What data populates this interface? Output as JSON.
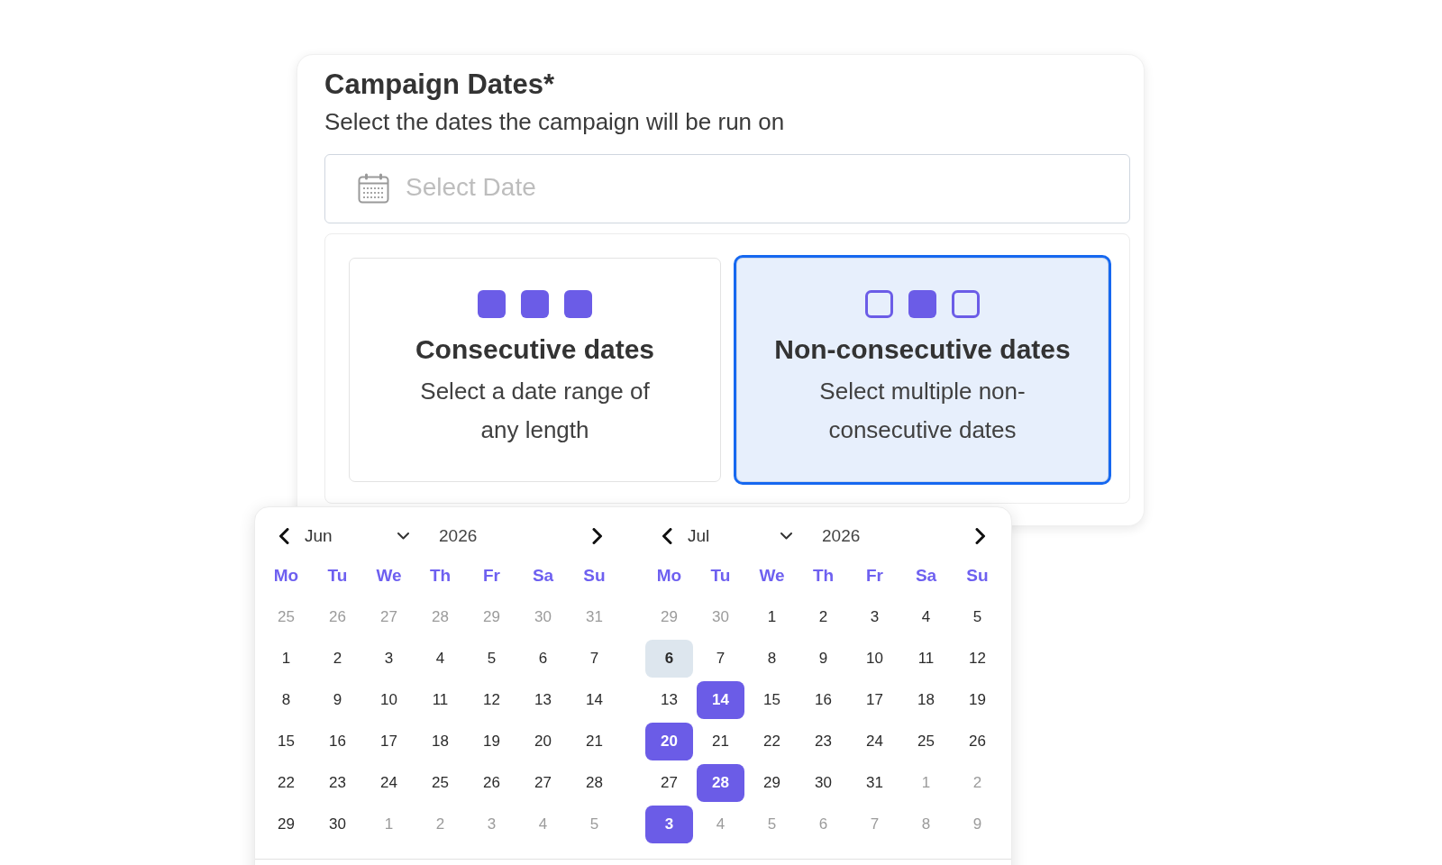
{
  "section": {
    "title": "Campaign Dates*",
    "subtitle": "Select the dates the campaign will be run on"
  },
  "date_field": {
    "placeholder": "Select Date"
  },
  "date_modes": [
    {
      "kind": "consecutive",
      "title": "Consecutive dates",
      "description": "Select a date range of any length",
      "selected": false
    },
    {
      "kind": "non_consecutive",
      "title": "Non-consecutive dates",
      "description": "Select multiple non-consecutive dates",
      "selected": true
    }
  ],
  "date_picker": {
    "months": [
      {
        "month": "Jun",
        "year": "2026",
        "weekdays": [
          "Mo",
          "Tu",
          "We",
          "Th",
          "Fr",
          "Sa",
          "Su"
        ],
        "weeks": [
          [
            {
              "day": "25",
              "outside": true,
              "today": false,
              "selected": false
            },
            {
              "day": "26",
              "outside": true,
              "today": false,
              "selected": false
            },
            {
              "day": "27",
              "outside": true,
              "today": false,
              "selected": false
            },
            {
              "day": "28",
              "outside": true,
              "today": false,
              "selected": false
            },
            {
              "day": "29",
              "outside": true,
              "today": false,
              "selected": false
            },
            {
              "day": "30",
              "outside": true,
              "today": false,
              "selected": false
            },
            {
              "day": "31",
              "outside": true,
              "today": false,
              "selected": false
            }
          ],
          [
            {
              "day": "1",
              "outside": false,
              "today": false,
              "selected": false
            },
            {
              "day": "2",
              "outside": false,
              "today": false,
              "selected": false
            },
            {
              "day": "3",
              "outside": false,
              "today": false,
              "selected": false
            },
            {
              "day": "4",
              "outside": false,
              "today": false,
              "selected": false
            },
            {
              "day": "5",
              "outside": false,
              "today": false,
              "selected": false
            },
            {
              "day": "6",
              "outside": false,
              "today": false,
              "selected": false
            },
            {
              "day": "7",
              "outside": false,
              "today": false,
              "selected": false
            }
          ],
          [
            {
              "day": "8",
              "outside": false,
              "today": false,
              "selected": false
            },
            {
              "day": "9",
              "outside": false,
              "today": false,
              "selected": false
            },
            {
              "day": "10",
              "outside": false,
              "today": false,
              "selected": false
            },
            {
              "day": "11",
              "outside": false,
              "today": false,
              "selected": false
            },
            {
              "day": "12",
              "outside": false,
              "today": false,
              "selected": false
            },
            {
              "day": "13",
              "outside": false,
              "today": false,
              "selected": false
            },
            {
              "day": "14",
              "outside": false,
              "today": false,
              "selected": false
            }
          ],
          [
            {
              "day": "15",
              "outside": false,
              "today": false,
              "selected": false
            },
            {
              "day": "16",
              "outside": false,
              "today": false,
              "selected": false
            },
            {
              "day": "17",
              "outside": false,
              "today": false,
              "selected": false
            },
            {
              "day": "18",
              "outside": false,
              "today": false,
              "selected": false
            },
            {
              "day": "19",
              "outside": false,
              "today": false,
              "selected": false
            },
            {
              "day": "20",
              "outside": false,
              "today": false,
              "selected": false
            },
            {
              "day": "21",
              "outside": false,
              "today": false,
              "selected": false
            }
          ],
          [
            {
              "day": "22",
              "outside": false,
              "today": false,
              "selected": false
            },
            {
              "day": "23",
              "outside": false,
              "today": false,
              "selected": false
            },
            {
              "day": "24",
              "outside": false,
              "today": false,
              "selected": false
            },
            {
              "day": "25",
              "outside": false,
              "today": false,
              "selected": false
            },
            {
              "day": "26",
              "outside": false,
              "today": false,
              "selected": false
            },
            {
              "day": "27",
              "outside": false,
              "today": false,
              "selected": false
            },
            {
              "day": "28",
              "outside": false,
              "today": false,
              "selected": false
            }
          ],
          [
            {
              "day": "29",
              "outside": false,
              "today": false,
              "selected": false
            },
            {
              "day": "30",
              "outside": false,
              "today": false,
              "selected": false
            },
            {
              "day": "1",
              "outside": true,
              "today": false,
              "selected": false
            },
            {
              "day": "2",
              "outside": true,
              "today": false,
              "selected": false
            },
            {
              "day": "3",
              "outside": true,
              "today": false,
              "selected": false
            },
            {
              "day": "4",
              "outside": true,
              "today": false,
              "selected": false
            },
            {
              "day": "5",
              "outside": true,
              "today": false,
              "selected": false
            }
          ]
        ]
      },
      {
        "month": "Jul",
        "year": "2026",
        "weekdays": [
          "Mo",
          "Tu",
          "We",
          "Th",
          "Fr",
          "Sa",
          "Su"
        ],
        "weeks": [
          [
            {
              "day": "29",
              "outside": true,
              "today": false,
              "selected": false
            },
            {
              "day": "30",
              "outside": true,
              "today": false,
              "selected": false
            },
            {
              "day": "1",
              "outside": false,
              "today": false,
              "selected": false
            },
            {
              "day": "2",
              "outside": false,
              "today": false,
              "selected": false
            },
            {
              "day": "3",
              "outside": false,
              "today": false,
              "selected": false
            },
            {
              "day": "4",
              "outside": false,
              "today": false,
              "selected": false
            },
            {
              "day": "5",
              "outside": false,
              "today": false,
              "selected": false
            }
          ],
          [
            {
              "day": "6",
              "outside": false,
              "today": true,
              "selected": false
            },
            {
              "day": "7",
              "outside": false,
              "today": false,
              "selected": false
            },
            {
              "day": "8",
              "outside": false,
              "today": false,
              "selected": false
            },
            {
              "day": "9",
              "outside": false,
              "today": false,
              "selected": false
            },
            {
              "day": "10",
              "outside": false,
              "today": false,
              "selected": false
            },
            {
              "day": "11",
              "outside": false,
              "today": false,
              "selected": false
            },
            {
              "day": "12",
              "outside": false,
              "today": false,
              "selected": false
            }
          ],
          [
            {
              "day": "13",
              "outside": false,
              "today": false,
              "selected": false
            },
            {
              "day": "14",
              "outside": false,
              "today": false,
              "selected": true
            },
            {
              "day": "15",
              "outside": false,
              "today": false,
              "selected": false
            },
            {
              "day": "16",
              "outside": false,
              "today": false,
              "selected": false
            },
            {
              "day": "17",
              "outside": false,
              "today": false,
              "selected": false
            },
            {
              "day": "18",
              "outside": false,
              "today": false,
              "selected": false
            },
            {
              "day": "19",
              "outside": false,
              "today": false,
              "selected": false
            }
          ],
          [
            {
              "day": "20",
              "outside": false,
              "today": false,
              "selected": true
            },
            {
              "day": "21",
              "outside": false,
              "today": false,
              "selected": false
            },
            {
              "day": "22",
              "outside": false,
              "today": false,
              "selected": false
            },
            {
              "day": "23",
              "outside": false,
              "today": false,
              "selected": false
            },
            {
              "day": "24",
              "outside": false,
              "today": false,
              "selected": false
            },
            {
              "day": "25",
              "outside": false,
              "today": false,
              "selected": false
            },
            {
              "day": "26",
              "outside": false,
              "today": false,
              "selected": false
            }
          ],
          [
            {
              "day": "27",
              "outside": false,
              "today": false,
              "selected": false
            },
            {
              "day": "28",
              "outside": false,
              "today": false,
              "selected": true
            },
            {
              "day": "29",
              "outside": false,
              "today": false,
              "selected": false
            },
            {
              "day": "30",
              "outside": false,
              "today": false,
              "selected": false
            },
            {
              "day": "31",
              "outside": false,
              "today": false,
              "selected": false
            },
            {
              "day": "1",
              "outside": true,
              "today": false,
              "selected": false
            },
            {
              "day": "2",
              "outside": true,
              "today": false,
              "selected": false
            }
          ],
          [
            {
              "day": "3",
              "outside": true,
              "today": false,
              "selected": true
            },
            {
              "day": "4",
              "outside": true,
              "today": false,
              "selected": false
            },
            {
              "day": "5",
              "outside": true,
              "today": false,
              "selected": false
            },
            {
              "day": "6",
              "outside": true,
              "today": false,
              "selected": false
            },
            {
              "day": "7",
              "outside": true,
              "today": false,
              "selected": false
            },
            {
              "day": "8",
              "outside": true,
              "today": false,
              "selected": false
            },
            {
              "day": "9",
              "outside": true,
              "today": false,
              "selected": false
            }
          ]
        ]
      }
    ]
  }
}
